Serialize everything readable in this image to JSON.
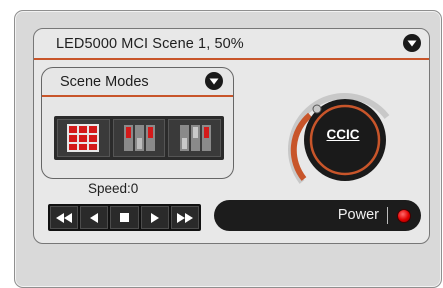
{
  "header": {
    "title": "LED5000 MCI  Scene 1, 50%"
  },
  "scene_modes": {
    "label": "Scene Modes",
    "modes": [
      "mode-1",
      "mode-2",
      "mode-3"
    ]
  },
  "speed": {
    "label": "Speed:0",
    "value": 0
  },
  "transport": {
    "buttons": [
      "rewind",
      "previous",
      "stop",
      "play",
      "fast-forward"
    ]
  },
  "knob": {
    "label": "CCIC",
    "level": 0.5
  },
  "power": {
    "label": "Power",
    "state": "on"
  },
  "colors": {
    "accent": "#c8552a",
    "panel": "#d9d9d9",
    "dark": "#1c1c1c",
    "led": "#e00000"
  }
}
